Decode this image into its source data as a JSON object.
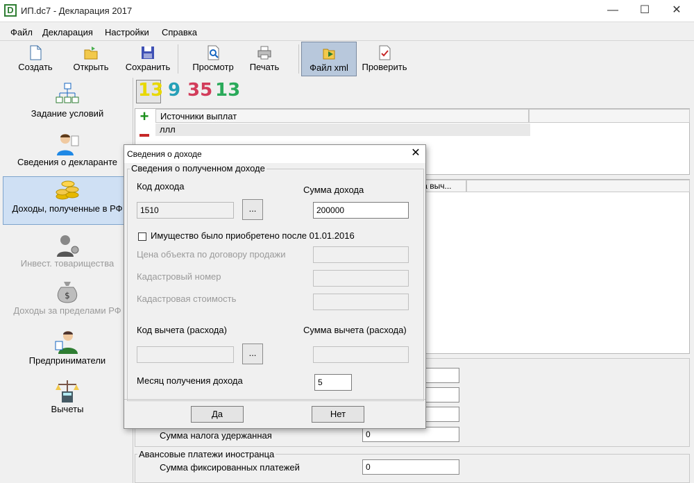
{
  "window": {
    "title": "ИП.dc7 - Декларация 2017",
    "icon_letter": "D",
    "minimize": "—",
    "maximize": "☐",
    "close": "✕"
  },
  "menu": [
    "Файл",
    "Декларация",
    "Настройки",
    "Справка"
  ],
  "toolbar": [
    {
      "label": "Создать",
      "icon": "new-document-icon"
    },
    {
      "label": "Открыть",
      "icon": "open-folder-icon"
    },
    {
      "label": "Сохранить",
      "icon": "save-disk-icon"
    },
    {
      "label": "Просмотр",
      "icon": "preview-magnifier-icon"
    },
    {
      "label": "Печать",
      "icon": "printer-icon"
    },
    {
      "label": "Файл xml",
      "icon": "xml-file-icon",
      "pressed": true
    },
    {
      "label": "Проверить",
      "icon": "check-document-icon"
    }
  ],
  "sidebar": [
    {
      "label": "Задание условий",
      "icon": "tree-icon",
      "state": "normal"
    },
    {
      "label": "Сведения о декларанте",
      "icon": "person-icon",
      "state": "normal"
    },
    {
      "label": "Доходы, полученные в РФ",
      "icon": "coins-icon",
      "state": "selected"
    },
    {
      "label": "Инвест. товарищества",
      "icon": "investor-icon",
      "state": "disabled"
    },
    {
      "label": "Доходы за пределами РФ",
      "icon": "money-bag-icon",
      "state": "disabled"
    },
    {
      "label": "Предприниматели",
      "icon": "entrepreneur-icon",
      "state": "normal"
    },
    {
      "label": "Вычеты",
      "icon": "scales-calculator-icon",
      "state": "normal"
    }
  ],
  "rate_tabs": [
    {
      "label": "13",
      "color": "#e8d800"
    },
    {
      "label": "9",
      "color": "#26a0b8"
    },
    {
      "label": "35",
      "color": "#d23c5a"
    },
    {
      "label": "13",
      "color": "#2aaa5a"
    }
  ],
  "sources": {
    "header": "Источники выплат",
    "rows": [
      "ллл"
    ]
  },
  "income_grid": {
    "header_partial": "ма выч..."
  },
  "tax_fields": {
    "withheld_label": "Сумма налога удержанная",
    "withheld_value": "0"
  },
  "advance": {
    "group_label": "Авансовые платежи иностранца",
    "fixed_label": "Сумма фиксированных платежей",
    "fixed_value": "0"
  },
  "dialog": {
    "title": "Сведения о доходе",
    "close": "✕",
    "group_label": "Сведения о полученном доходе",
    "income_code_label": "Код дохода",
    "income_code_value": "1510",
    "dots": "...",
    "income_sum_label": "Сумма дохода",
    "income_sum_value": "200000",
    "property_checkbox_label": "Имущество было приобретено после 01.01.2016",
    "property_checked": false,
    "contract_price_label": "Цена объекта по договору продажи",
    "cadastral_number_label": "Кадастровый номер",
    "cadastral_value_label": "Кадастровая стоимость",
    "deduction_code_label": "Код вычета (расхода)",
    "deduction_sum_label": "Сумма вычета (расхода)",
    "month_label": "Месяц получения дохода",
    "month_value": "5",
    "ok": "Да",
    "cancel": "Нет"
  }
}
